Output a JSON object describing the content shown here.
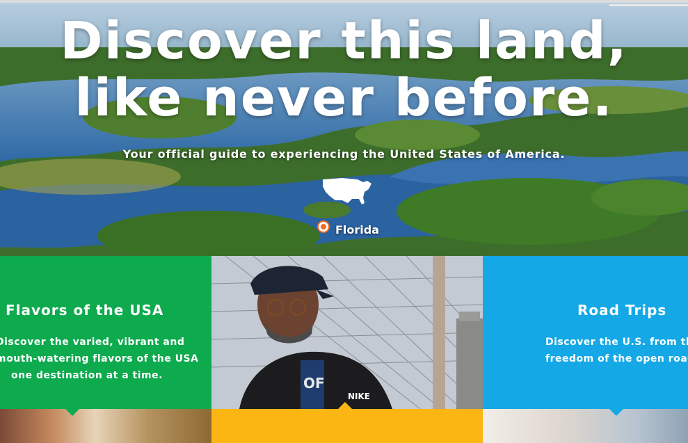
{
  "hero": {
    "title_line1": "Discover this land,",
    "title_line2": "like never before.",
    "subtitle": "Your official guide to experiencing the United States of America.",
    "location_label": "Florida",
    "pin_color": "#f26b21"
  },
  "tiles": {
    "flavors": {
      "heading": "Flavors of the USA",
      "line1": "Discover the varied, vibrant and",
      "line2": "mouth-watering flavors of the USA",
      "line3": "one destination at a time.",
      "color": "#0eaa4e"
    },
    "road_trips": {
      "heading": "Road Trips",
      "line1": "Discover the U.S. from the",
      "line2": "freedom of the open road.",
      "color": "#14a8e6"
    },
    "photo": {
      "jacket_text": "OF",
      "brand_text": "NIKE"
    }
  },
  "icons": {
    "usa_map": "usa-map-icon",
    "location_pin": "location-pin-icon"
  },
  "bottom_strip": {
    "middle_color": "#fbb614"
  }
}
